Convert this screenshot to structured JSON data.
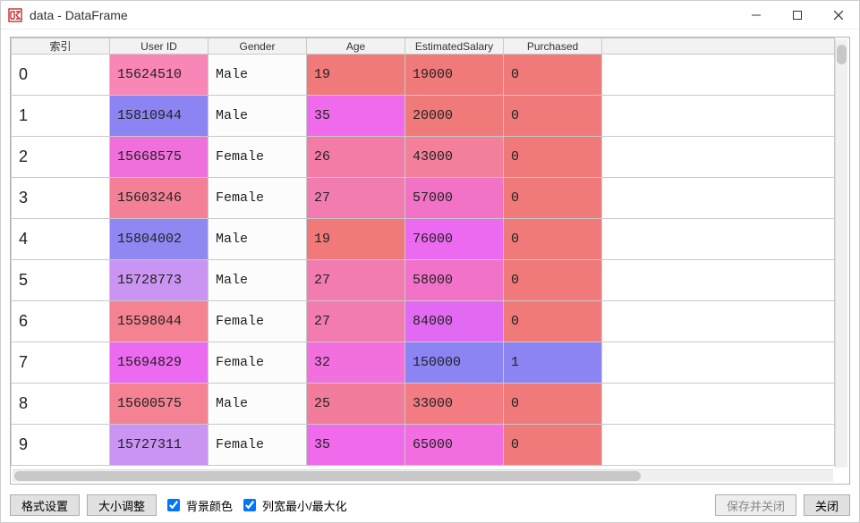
{
  "window": {
    "title": "data - DataFrame"
  },
  "table": {
    "index_header": "索引",
    "columns": [
      "User ID",
      "Gender",
      "Age",
      "EstimatedSalary",
      "Purchased"
    ],
    "rows": [
      {
        "index": "0",
        "user_id": "15624510",
        "gender": "Male",
        "age": "19",
        "salary": "19000",
        "purchased": "0",
        "bg": {
          "user_id": "#f886b6",
          "gender": "#fcfcfc",
          "age": "#f07a7a",
          "salary": "#f07a7a",
          "purchased": "#f07a7a"
        }
      },
      {
        "index": "1",
        "user_id": "15810944",
        "gender": "Male",
        "age": "35",
        "salary": "20000",
        "purchased": "0",
        "bg": {
          "user_id": "#8c84f2",
          "gender": "#fcfcfc",
          "age": "#f06aec",
          "salary": "#f07a7a",
          "purchased": "#f07a7a"
        }
      },
      {
        "index": "2",
        "user_id": "15668575",
        "gender": "Female",
        "age": "26",
        "salary": "43000",
        "purchased": "0",
        "bg": {
          "user_id": "#f070db",
          "gender": "#fcfcfc",
          "age": "#f27ca6",
          "salary": "#f2809a",
          "purchased": "#f07a7a"
        }
      },
      {
        "index": "3",
        "user_id": "15603246",
        "gender": "Female",
        "age": "27",
        "salary": "57000",
        "purchased": "0",
        "bg": {
          "user_id": "#f48097",
          "gender": "#fcfcfc",
          "age": "#f27cb0",
          "salary": "#f272c6",
          "purchased": "#f07a7a"
        }
      },
      {
        "index": "4",
        "user_id": "15804002",
        "gender": "Male",
        "age": "19",
        "salary": "76000",
        "purchased": "0",
        "bg": {
          "user_id": "#9088f2",
          "gender": "#fcfcfc",
          "age": "#f07a7a",
          "salary": "#ec6af0",
          "purchased": "#f07a7a"
        }
      },
      {
        "index": "5",
        "user_id": "15728773",
        "gender": "Male",
        "age": "27",
        "salary": "58000",
        "purchased": "0",
        "bg": {
          "user_id": "#ca94f2",
          "gender": "#fcfcfc",
          "age": "#f27cb0",
          "salary": "#f272ca",
          "purchased": "#f07a7a"
        }
      },
      {
        "index": "6",
        "user_id": "15598044",
        "gender": "Female",
        "age": "27",
        "salary": "84000",
        "purchased": "0",
        "bg": {
          "user_id": "#f48290",
          "gender": "#fcfcfc",
          "age": "#f27cb0",
          "salary": "#e26af2",
          "purchased": "#f07a7a"
        }
      },
      {
        "index": "7",
        "user_id": "15694829",
        "gender": "Female",
        "age": "32",
        "salary": "150000",
        "purchased": "1",
        "bg": {
          "user_id": "#ec6af0",
          "gender": "#fcfcfc",
          "age": "#f270de",
          "salary": "#8c84f2",
          "purchased": "#8c84f2"
        }
      },
      {
        "index": "8",
        "user_id": "15600575",
        "gender": "Male",
        "age": "25",
        "salary": "33000",
        "purchased": "0",
        "bg": {
          "user_id": "#f48293",
          "gender": "#fcfcfc",
          "age": "#f27c9c",
          "salary": "#f27c82",
          "purchased": "#f07a7a"
        }
      },
      {
        "index": "9",
        "user_id": "15727311",
        "gender": "Female",
        "age": "35",
        "salary": "65000",
        "purchased": "0",
        "bg": {
          "user_id": "#ca94f2",
          "gender": "#fcfcfc",
          "age": "#f06aec",
          "salary": "#f26ee0",
          "purchased": "#f07a7a"
        }
      }
    ]
  },
  "toolbar": {
    "format_btn": "格式设置",
    "resize_btn": "大小调整",
    "bg_color_chk": "背景颜色",
    "column_width_chk": "列宽最小/最大化",
    "save_close_btn": "保存并关闭",
    "close_btn": "关闭"
  }
}
